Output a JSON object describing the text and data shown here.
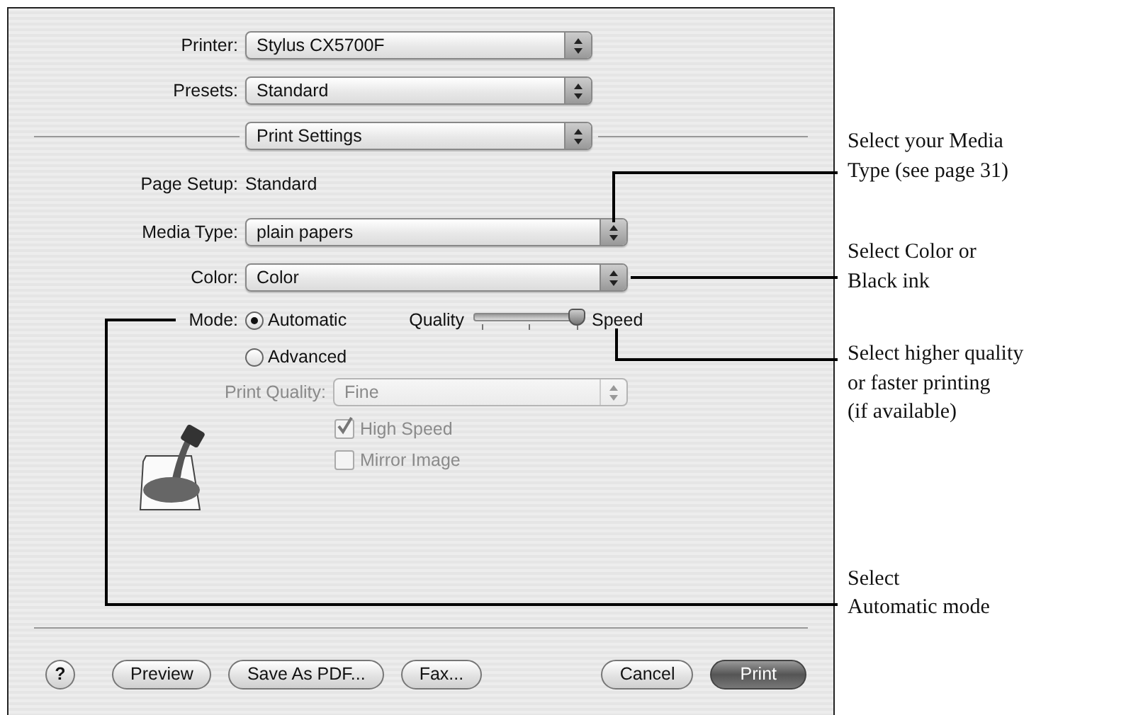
{
  "dialog": {
    "popups": [
      {
        "label": "Printer:",
        "value": "Stylus CX5700F"
      },
      {
        "label": "Presets:",
        "value": "Standard"
      }
    ],
    "panel_menu": {
      "value": "Print Settings"
    },
    "page_setup": {
      "label": "Page Setup:",
      "value": "Standard"
    },
    "media_type": {
      "label": "Media Type:",
      "value": "plain papers"
    },
    "color": {
      "label": "Color:",
      "value": "Color"
    },
    "mode": {
      "label": "Mode:",
      "options": [
        {
          "label": "Automatic",
          "selected": true
        },
        {
          "label": "Advanced",
          "selected": false
        }
      ]
    },
    "quality_slider": {
      "left_label": "Quality",
      "right_label": "Speed",
      "level": 1
    },
    "print_quality": {
      "label": "Print Quality:",
      "value": "Fine",
      "disabled": true
    },
    "checkboxes": [
      {
        "label": "High Speed",
        "checked": true,
        "disabled": true
      },
      {
        "label": "Mirror Image",
        "checked": false,
        "disabled": true
      }
    ],
    "buttons": [
      {
        "label": "?",
        "kind": "help"
      },
      {
        "label": "Preview",
        "kind": "normal"
      },
      {
        "label": "Save As PDF...",
        "kind": "normal"
      },
      {
        "label": "Fax...",
        "kind": "normal"
      },
      {
        "label": "Cancel",
        "kind": "normal"
      },
      {
        "label": "Print",
        "kind": "default"
      }
    ]
  },
  "callouts": [
    {
      "lines": [
        "Select your Media",
        "Type (see page 31)"
      ]
    },
    {
      "lines": [
        "Select Color or",
        "Black ink"
      ]
    },
    {
      "lines": [
        "Select higher quality",
        "or faster printing",
        "(if available)"
      ]
    },
    {
      "lines": [
        "Select",
        "Automatic mode"
      ]
    }
  ]
}
